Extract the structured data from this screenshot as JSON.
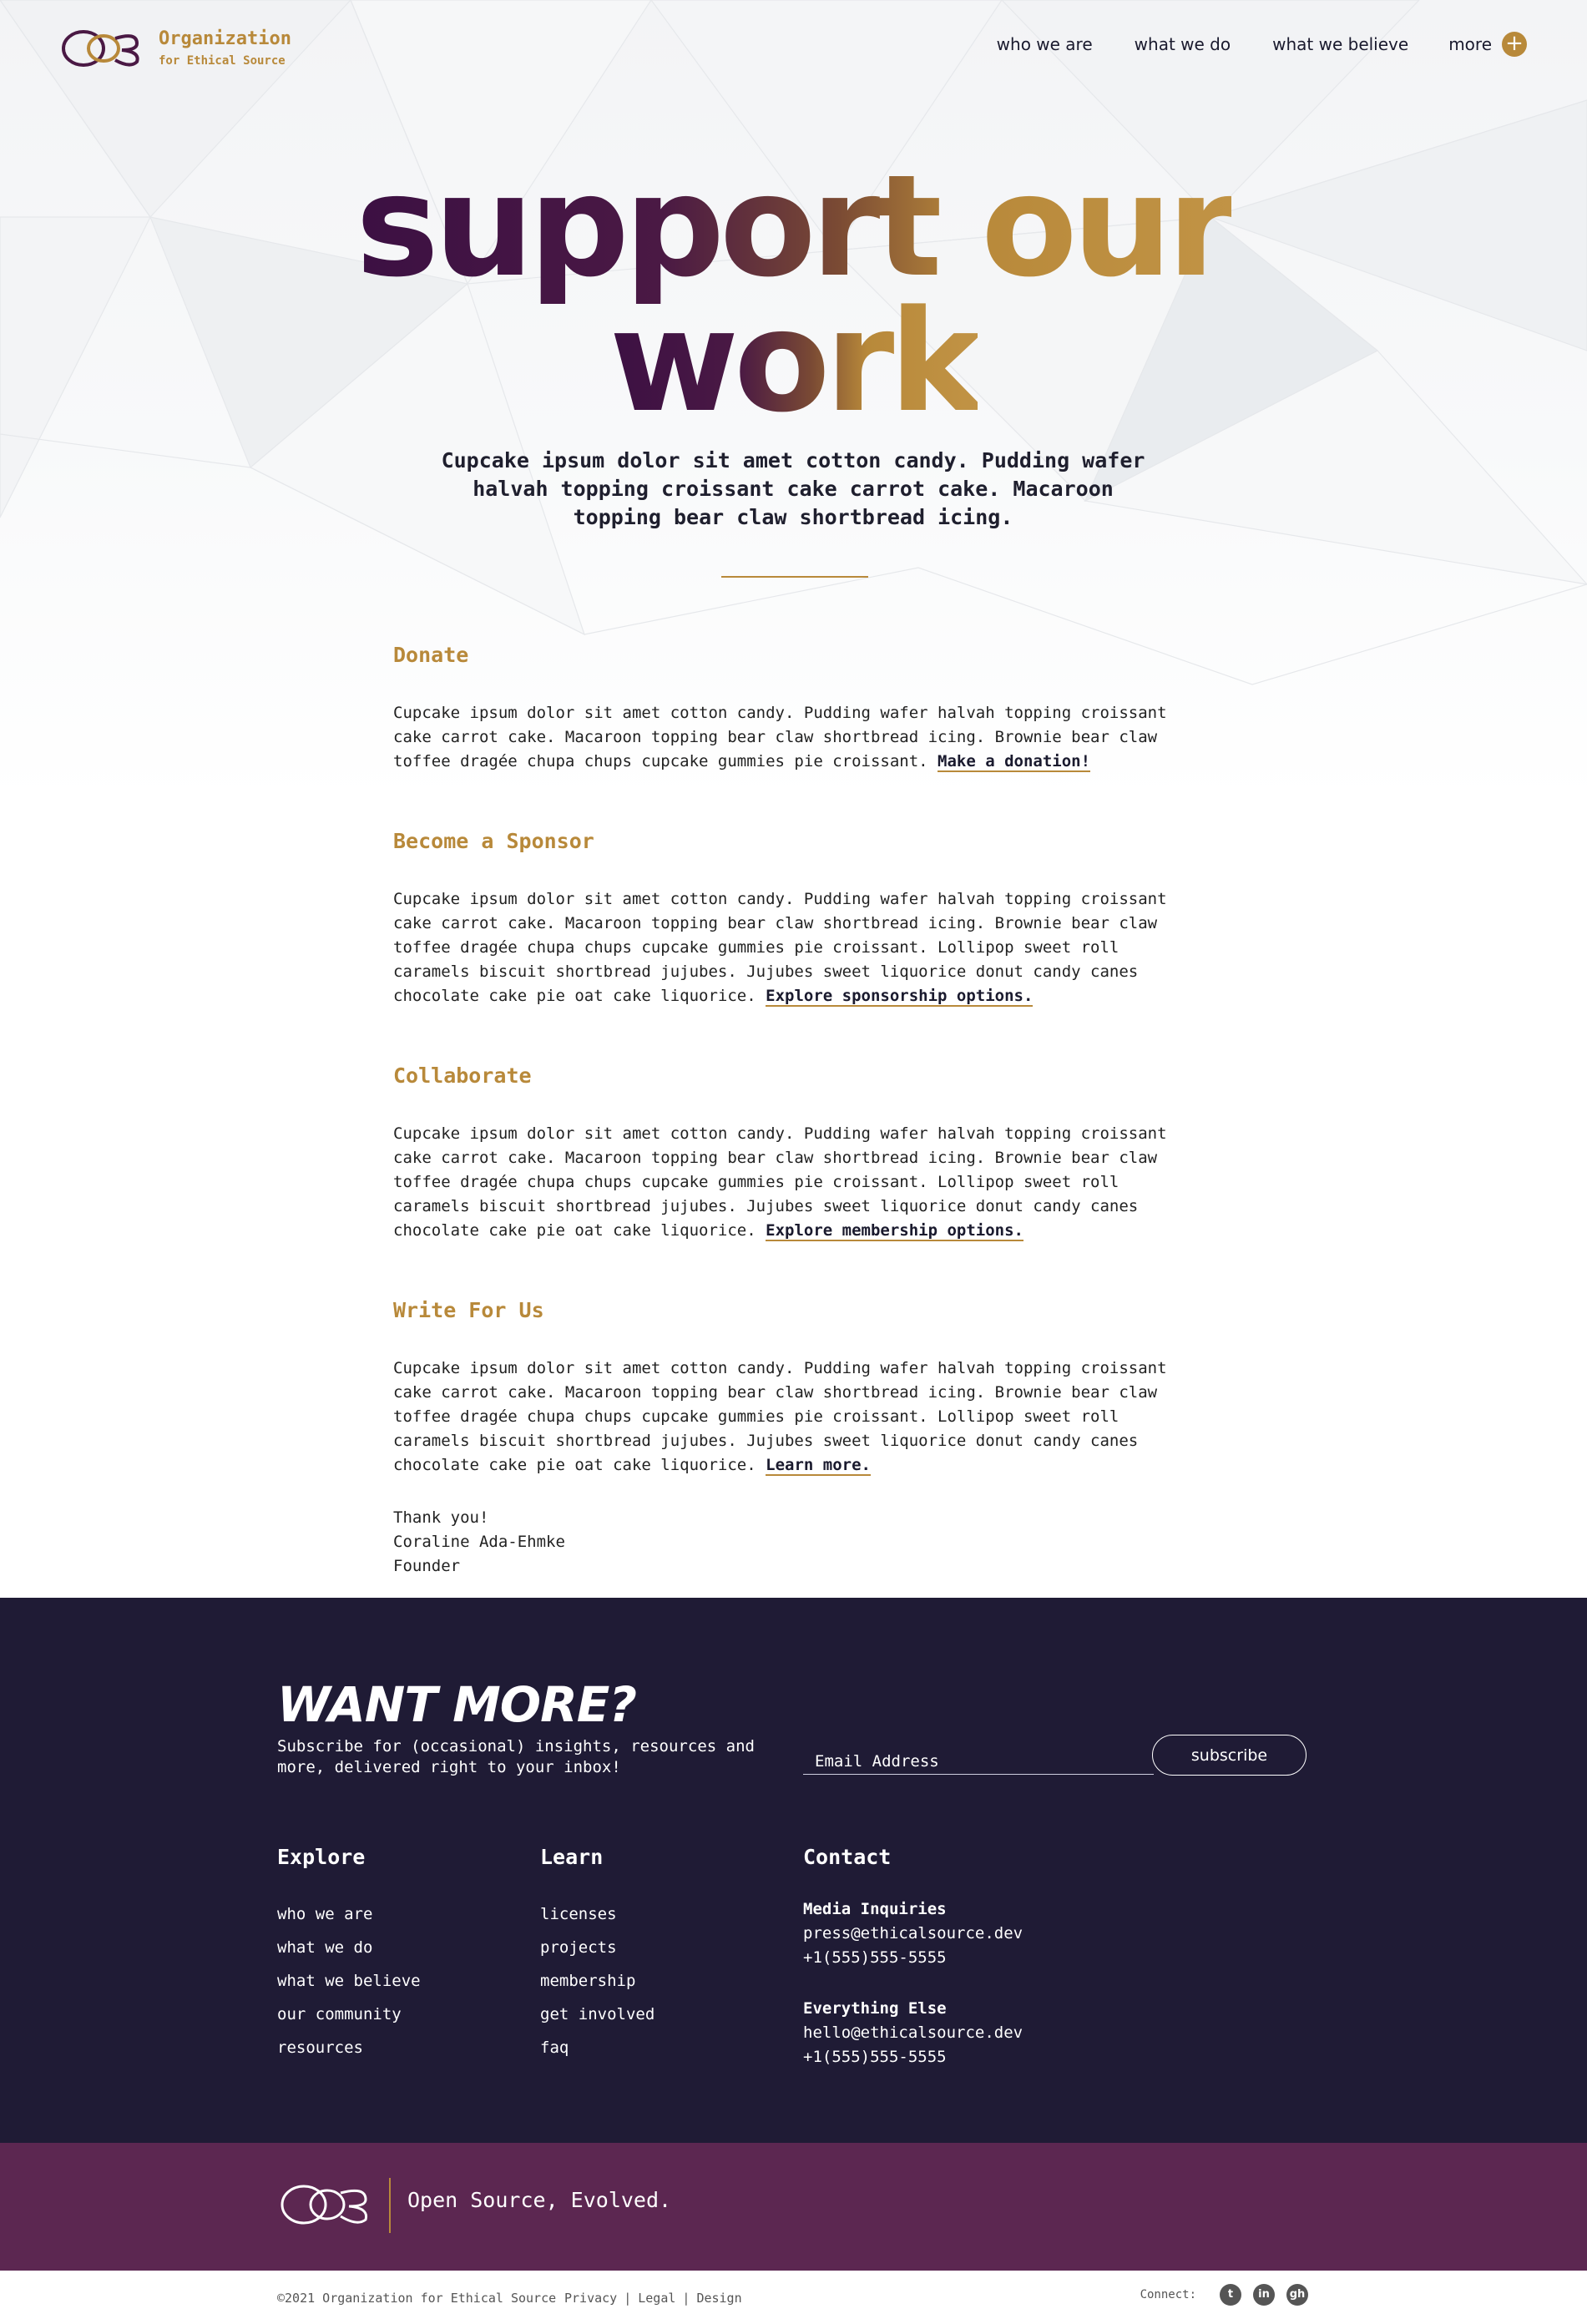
{
  "brand": {
    "name_line1": "Organization",
    "name_line2": "for Ethical Source"
  },
  "nav": {
    "items": [
      "who we are",
      "what we do",
      "what we believe"
    ],
    "more_label": "more"
  },
  "hero": {
    "title_line1": "support our",
    "title_line2": "work",
    "subtitle": "Cupcake ipsum dolor sit amet cotton candy. Pudding wafer halvah topping croissant cake carrot cake. Macaroon topping bear claw shortbread icing."
  },
  "sections": [
    {
      "heading": "Donate",
      "body": "Cupcake ipsum dolor sit amet cotton candy. Pudding wafer halvah topping croissant cake carrot cake. Macaroon topping bear claw shortbread icing. Brownie bear claw toffee dragée chupa chups cupcake gummies pie croissant. ",
      "link": "Make a donation!"
    },
    {
      "heading": "Become a Sponsor",
      "body": "Cupcake ipsum dolor sit amet cotton candy. Pudding wafer halvah topping croissant cake carrot cake. Macaroon topping bear claw shortbread icing. Brownie bear claw toffee dragée chupa chups cupcake gummies pie croissant. Lollipop sweet roll caramels biscuit shortbread jujubes. Jujubes sweet liquorice donut candy canes chocolate cake pie oat cake liquorice. ",
      "link": "Explore sponsorship options."
    },
    {
      "heading": "Collaborate",
      "body": "Cupcake ipsum dolor sit amet cotton candy. Pudding wafer halvah topping croissant cake carrot cake. Macaroon topping bear claw shortbread icing. Brownie bear claw toffee dragée chupa chups cupcake gummies pie croissant. Lollipop sweet roll caramels biscuit shortbread jujubes. Jujubes sweet liquorice donut candy canes chocolate cake pie oat cake liquorice. ",
      "link": "Explore membership options."
    },
    {
      "heading": "Write For Us",
      "body": "Cupcake ipsum dolor sit amet cotton candy. Pudding wafer halvah topping croissant cake carrot cake. Macaroon topping bear claw shortbread icing. Brownie bear claw toffee dragée chupa chups cupcake gummies pie croissant. Lollipop sweet roll caramels biscuit shortbread jujubes. Jujubes sweet liquorice donut candy canes chocolate cake pie oat cake liquorice. ",
      "link": "Learn more."
    }
  ],
  "signoff": {
    "line1": "Thank you!",
    "line2": "Coraline Ada-Ehmke",
    "line3": "Founder"
  },
  "newsletter": {
    "title": "WANT MORE?",
    "subtitle": "Subscribe for (occasional) insights, resources and more, delivered right to your inbox!",
    "email_placeholder": "Email Address",
    "button": "subscribe"
  },
  "footer": {
    "explore": {
      "heading": "Explore",
      "items": [
        "who we are",
        "what we do",
        "what we believe",
        "our community",
        "resources"
      ]
    },
    "learn": {
      "heading": "Learn",
      "items": [
        "licenses",
        "projects",
        "membership",
        "get involved",
        "faq"
      ]
    },
    "contact": {
      "heading": "Contact",
      "media": {
        "label": "Media Inquiries",
        "email": "press@ethicalsource.dev",
        "phone": "+1(555)555-5555"
      },
      "other": {
        "label": "Everything Else",
        "email": "hello@ethicalsource.dev",
        "phone": "+1(555)555-5555"
      }
    },
    "tagline": "Open Source, Evolved.",
    "copyright": "©2021 Organization for Ethical Source",
    "legal": [
      "Privacy",
      "Legal",
      "Design"
    ],
    "connect_label": "Connect:",
    "social_icons": [
      "twitter-icon",
      "linkedin-icon",
      "github-icon"
    ]
  },
  "colors": {
    "accent_gold": "#b8893a",
    "deep_purple": "#3c1043",
    "footer_navy": "#1f1b35",
    "footer_plum": "#5c2751"
  }
}
